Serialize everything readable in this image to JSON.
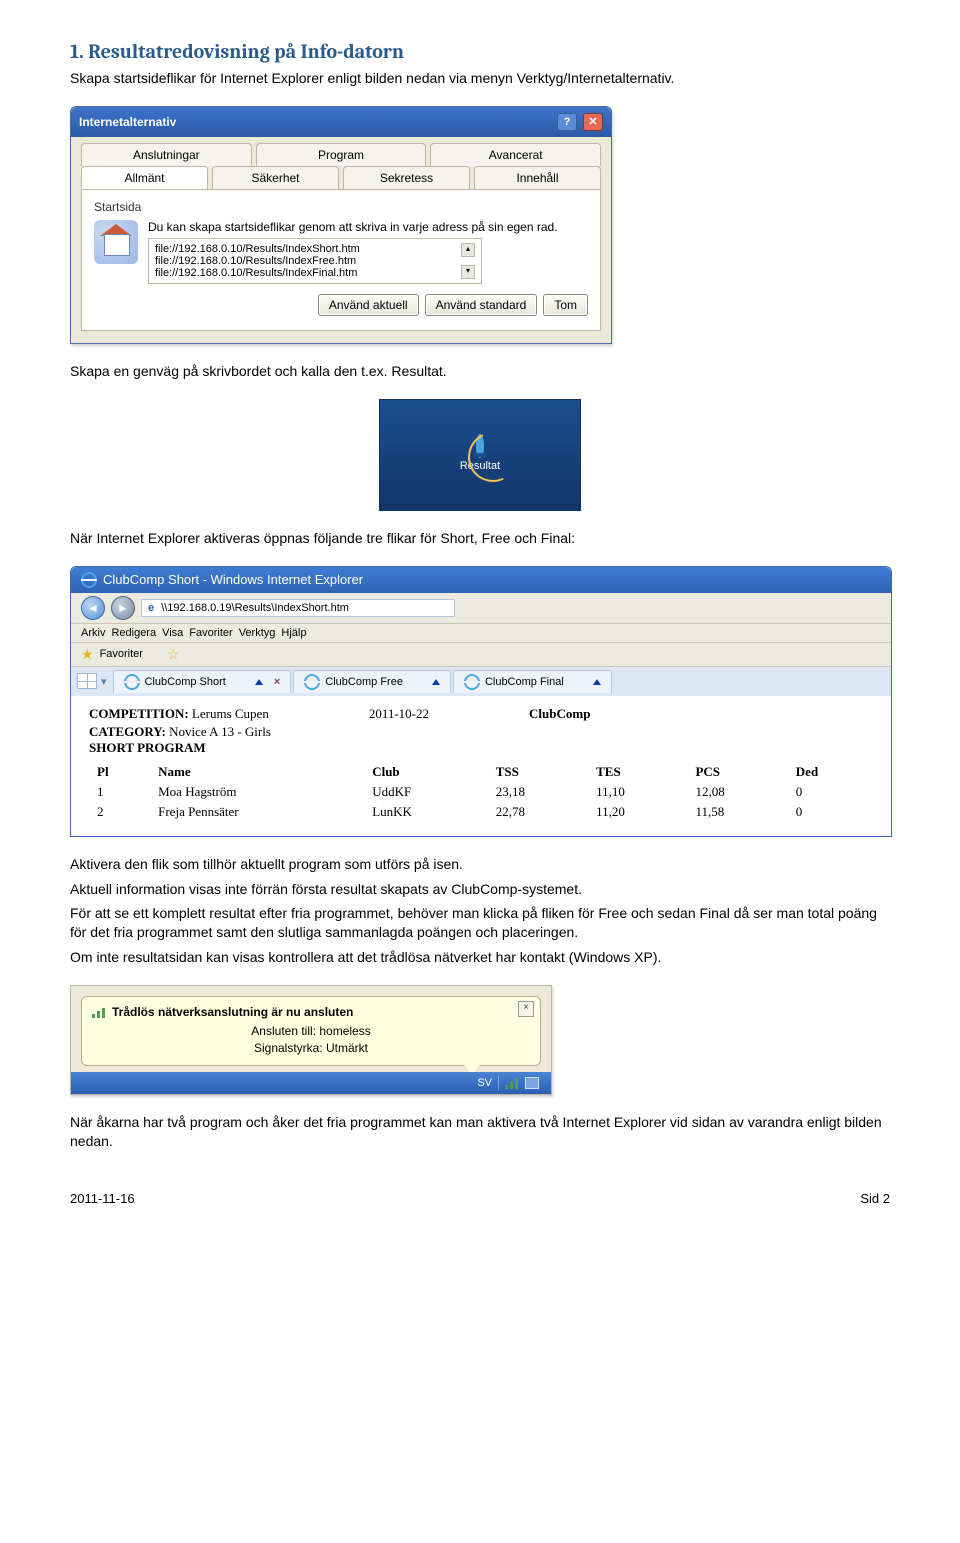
{
  "section_heading": "1. Resultatredovisning på Info-datorn",
  "intro": "Skapa startsideflikar för Internet Explorer enligt bilden nedan via menyn Verktyg/Internetalternativ.",
  "options_window": {
    "title": "Internetalternativ",
    "tabs_row1": [
      "Anslutningar",
      "Program",
      "Avancerat"
    ],
    "tabs_row2": [
      "Allmänt",
      "Säkerhet",
      "Sekretess",
      "Innehåll"
    ],
    "active_tab": "Allmänt",
    "group": "Startsida",
    "desc": "Du kan skapa startsideflikar genom att skriva in varje adress på sin egen rad.",
    "urls": [
      "file://192.168.0.10/Results/IndexShort.htm",
      "file://192.168.0.10/Results/IndexFree.htm",
      "file://192.168.0.10/Results/IndexFinal.htm"
    ],
    "buttons": [
      "Använd aktuell",
      "Använd standard",
      "Tom"
    ]
  },
  "p2": "Skapa en genväg på skrivbordet och kalla den t.ex. Resultat.",
  "desktop_icon_label": "Resultat",
  "p3": "När Internet Explorer aktiveras öppnas följande tre flikar för Short, Free och Final:",
  "browser": {
    "title": "ClubComp Short - Windows Internet Explorer",
    "address": "\\\\192.168.0.19\\Results\\IndexShort.htm",
    "address_icon_label": "e",
    "menus": [
      "Arkiv",
      "Redigera",
      "Visa",
      "Favoriter",
      "Verktyg",
      "Hjälp"
    ],
    "fav_label": "Favoriter",
    "tabs": [
      {
        "label": "ClubComp Short",
        "closeable": true
      },
      {
        "label": "ClubComp Free",
        "closeable": false
      },
      {
        "label": "ClubComp Final",
        "closeable": false
      }
    ],
    "competition_label": "COMPETITION:",
    "competition_value": "Lerums Cupen",
    "date": "2011-10-22",
    "brand": "ClubComp",
    "category_label": "CATEGORY:",
    "category_value": "Novice A 13 - Girls",
    "program": "SHORT PROGRAM",
    "columns": [
      "Pl",
      "Name",
      "Club",
      "TSS",
      "TES",
      "PCS",
      "Ded"
    ],
    "rows": [
      {
        "pl": "1",
        "name": "Moa Hagström",
        "club": "UddKF",
        "tss": "23,18",
        "tes": "11,10",
        "pcs": "12,08",
        "ded": "0"
      },
      {
        "pl": "2",
        "name": "Freja Pennsäter",
        "club": "LunKK",
        "tss": "22,78",
        "tes": "11,20",
        "pcs": "11,58",
        "ded": "0"
      }
    ]
  },
  "p4": "Aktivera den flik som tillhör aktuellt program som utförs på isen.",
  "p5": "Aktuell information visas inte förrän första resultat skapats av ClubComp-systemet.",
  "p6": "För att se ett komplett resultat efter fria programmet, behöver man klicka på fliken för Free och sedan Final då ser man total poäng för det fria programmet samt den slutliga sammanlagda poängen och placeringen.",
  "p7": "Om inte resultatsidan kan visas kontrollera att det trådlösa nätverket har kontakt (Windows XP).",
  "balloon": {
    "title": "Trådlös nätverksanslutning är nu ansluten",
    "line1_label": "Ansluten till:",
    "line1_value": "homeless",
    "line2_label": "Signalstyrka:",
    "line2_value": "Utmärkt",
    "lang": "SV"
  },
  "p8": "När åkarna har två program och åker det fria programmet kan man aktivera två Internet Explorer vid sidan av varandra enligt bilden nedan.",
  "footer_date": "2011-11-16",
  "footer_page": "Sid 2"
}
